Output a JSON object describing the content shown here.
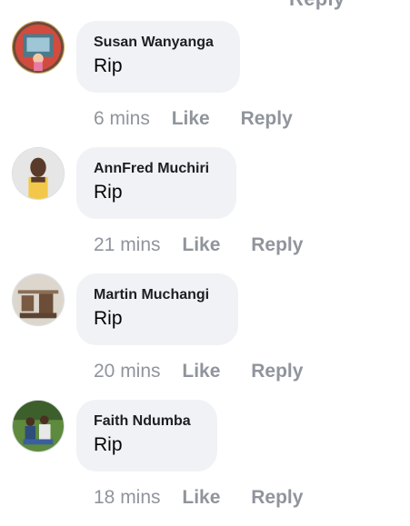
{
  "top_fragment": "Reply",
  "comments": [
    {
      "author": "Susan Wanyanga",
      "text": "Rip",
      "time": "6 mins",
      "like": "Like",
      "reply": "Reply",
      "avatar_icon": "user-photo-avatar"
    },
    {
      "author": "AnnFred Muchiri",
      "text": "Rip",
      "time": "21 mins",
      "like": "Like",
      "reply": "Reply",
      "avatar_icon": "user-photo-avatar"
    },
    {
      "author": "Martin Muchangi",
      "text": "Rip",
      "time": "20 mins",
      "like": "Like",
      "reply": "Reply",
      "avatar_icon": "user-photo-avatar"
    },
    {
      "author": "Faith Ndumba",
      "text": "Rip",
      "time": "18 mins",
      "like": "Like",
      "reply": "Reply",
      "avatar_icon": "user-photo-avatar"
    }
  ],
  "colors": {
    "bubble": "#f0f2f5",
    "meta_text": "#90949c",
    "author_text": "#1c1e21"
  }
}
